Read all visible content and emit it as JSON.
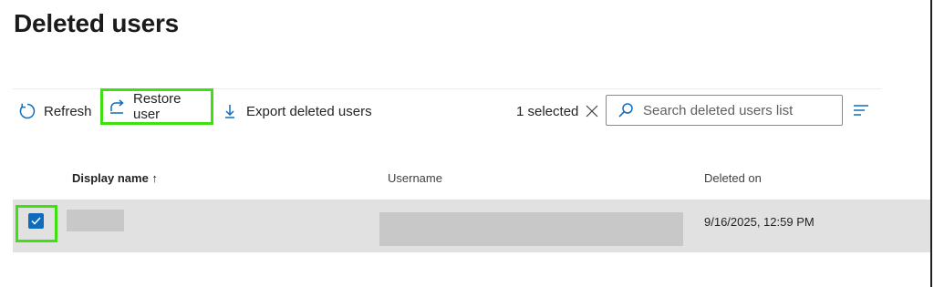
{
  "page": {
    "title": "Deleted users"
  },
  "toolbar": {
    "refresh_label": "Refresh",
    "restore_label": "Restore user",
    "export_label": "Export deleted users",
    "selected_text": "1 selected",
    "icons": {
      "refresh": "refresh-icon",
      "restore": "restore-icon",
      "export": "download-icon",
      "clear": "close-icon",
      "search": "search-icon",
      "filter": "filter-lines-icon"
    }
  },
  "search": {
    "placeholder": "Search deleted users list",
    "value": ""
  },
  "table": {
    "columns": [
      "Display name ↑",
      "Username",
      "Deleted on"
    ],
    "sort_indicator": "ascending",
    "rows": [
      {
        "selected": true,
        "display_name": "",
        "username": "",
        "deleted_on": "9/16/2025, 12:59 PM"
      }
    ]
  },
  "colors": {
    "accent": "#0f6cbd",
    "highlight": "#3ee00f",
    "selected_row": "#e1e1e1",
    "redaction": "#c8c8c8"
  }
}
